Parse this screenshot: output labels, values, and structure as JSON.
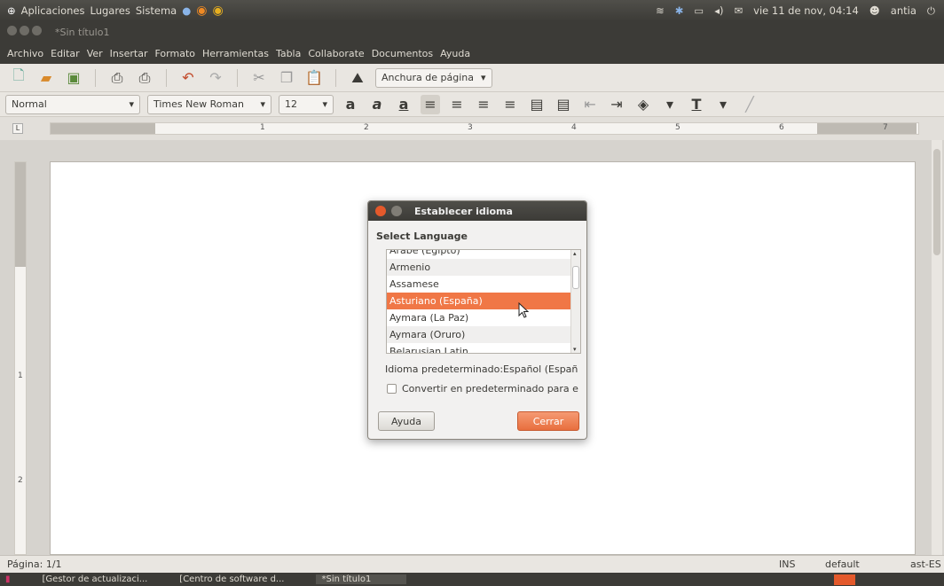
{
  "top_panel": {
    "menu": [
      "Aplicaciones",
      "Lugares",
      "Sistema"
    ],
    "datetime": "vie 11 de nov, 04:14",
    "user": "antia"
  },
  "window": {
    "title": "*Sin título1"
  },
  "menubar": [
    "Archivo",
    "Editar",
    "Ver",
    "Insertar",
    "Formato",
    "Herramientas",
    "Tabla",
    "Collaborate",
    "Documentos",
    "Ayuda"
  ],
  "toolbar": {
    "zoom": "Anchura de página",
    "style": "Normal",
    "font": "Times New Roman",
    "size": "12"
  },
  "ruler": {
    "numbers": [
      "1",
      "2",
      "3",
      "4",
      "5",
      "6",
      "7"
    ]
  },
  "vruler": {
    "numbers": [
      "1",
      "2"
    ]
  },
  "dialog": {
    "title": "Establecer idioma",
    "label": "Select Language",
    "languages": [
      "Árabe (Egipto)",
      "Armenio",
      "Assamese",
      "Asturiano (España)",
      "Aymara (La Paz)",
      "Aymara (Oruro)",
      "Belarusian Latin"
    ],
    "selected": "Asturiano (España)",
    "default_text": "Idioma predeterminado:Español (Españ",
    "checkbox_label": "Convertir en predeterminado para e",
    "help_label": "Ayuda",
    "close_label": "Cerrar"
  },
  "statusbar": {
    "page": "Página: 1/1",
    "ins": "INS",
    "style": "default",
    "lang": "ast-ES"
  },
  "taskbar": [
    "[Gestor de actualizaci...",
    "[Centro de software d...",
    "*Sin título1"
  ],
  "colors": {
    "accent": "#f07746",
    "panel": "#3c3b37"
  }
}
